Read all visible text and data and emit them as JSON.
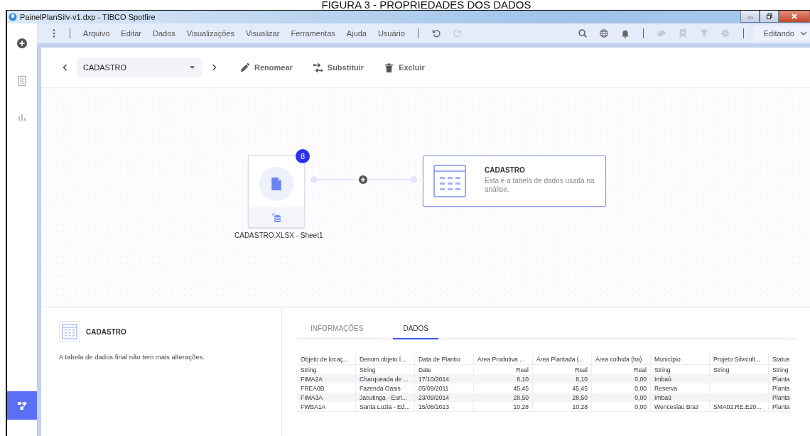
{
  "caption": "FIGURA 3 - PROPRIEDADES DOS DADOS",
  "window": {
    "title": "PainelPlanSilv-v1.dxp - TIBCO Spotfire"
  },
  "menu": [
    "Arquivo",
    "Editar",
    "Dados",
    "Visualizações",
    "Visualizar",
    "Ferramentas",
    "Ajuda",
    "Usuário"
  ],
  "history_icons": [
    {
      "kind": "undo",
      "disabled": false
    },
    {
      "kind": "redo",
      "disabled": true
    }
  ],
  "tool_icons": [
    {
      "kind": "search",
      "disabled": false
    },
    {
      "kind": "globe",
      "disabled": false
    },
    {
      "kind": "bell",
      "disabled": false
    },
    {
      "kind": "comment",
      "disabled": true
    },
    {
      "kind": "bookmark",
      "disabled": true
    },
    {
      "kind": "filter",
      "disabled": true
    },
    {
      "kind": "gear",
      "disabled": true
    }
  ],
  "mode": "Editando",
  "sidebar": {
    "items": [
      {
        "kind": "add",
        "selected": false
      },
      {
        "kind": "pages",
        "selected": false
      },
      {
        "kind": "chart",
        "selected": false
      },
      {
        "kind": "data",
        "selected": true
      }
    ]
  },
  "toolbar": {
    "table_select": "CADASTRO",
    "actions": [
      {
        "kind": "rename",
        "label": "Renomear"
      },
      {
        "kind": "replace",
        "label": "Substituir"
      },
      {
        "kind": "delete",
        "label": "Excluir"
      }
    ]
  },
  "flow": {
    "source": {
      "label": "CADASTRO.XLSX - Sheet1",
      "badge": "8"
    },
    "target": {
      "title": "CADASTRO",
      "description": "Esta é a tabela de dados usada na análise."
    }
  },
  "details": {
    "title": "CADASTRO",
    "message": "A tabela de dados final não tem mais alterações."
  },
  "tabs": [
    {
      "label": "INFORMAÇÕES",
      "selected": false
    },
    {
      "label": "DADOS",
      "selected": true
    }
  ],
  "table": {
    "columns": [
      {
        "name": "Objeto de locaç...",
        "type": "String",
        "numeric": false
      },
      {
        "name": "Denom.objeto l...",
        "type": "String",
        "numeric": false
      },
      {
        "name": "Data de Plantio",
        "type": "Date",
        "numeric": false
      },
      {
        "name": "Área Produtiva ...",
        "type": "Real",
        "numeric": true
      },
      {
        "name": "Área Plantada (...",
        "type": "Real",
        "numeric": true
      },
      {
        "name": "Área colhida (ha)",
        "type": "Real",
        "numeric": true
      },
      {
        "name": "Município",
        "type": "String",
        "numeric": false
      },
      {
        "name": "Projeto Silvicult...",
        "type": "String",
        "numeric": false
      },
      {
        "name": "Status",
        "type": "String",
        "numeric": false
      }
    ],
    "rows": [
      [
        "FIMA2A",
        "Charqueada de ...",
        "17/10/2014",
        "8,10",
        "8,10",
        "0,00",
        "Imbaú",
        null,
        "Planta"
      ],
      [
        "FREA0B",
        "Fazenda Oasis",
        "05/09/2011",
        "45,45",
        "45,45",
        "0,00",
        "Reserva",
        null,
        "Planta"
      ],
      [
        "FIMA3A",
        "Jacutinga - Euri...",
        "23/09/2014",
        "28,50",
        "28,50",
        "0,00",
        "Imbaú",
        null,
        "Planta"
      ],
      [
        "FWBA1A",
        "Santa Luzia - Ed...",
        "15/08/2013",
        "10,28",
        "10,28",
        "0,00",
        "Wenceslau Braz",
        "SMA02.RE.E20...",
        "Planta"
      ]
    ]
  }
}
